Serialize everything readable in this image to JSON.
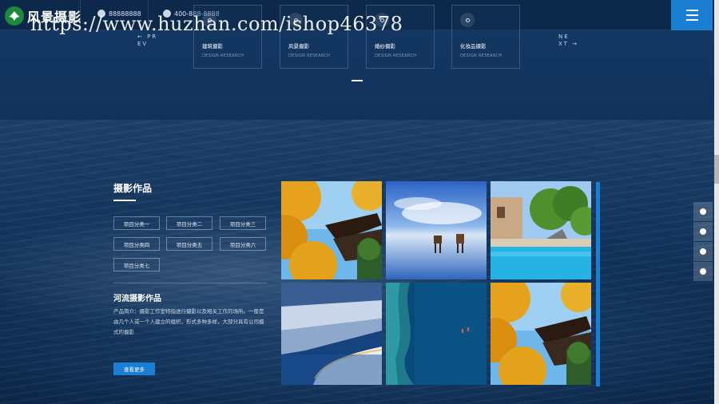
{
  "logo": {
    "text": "风景摄影"
  },
  "header": {
    "email": "88888888",
    "phone": "400-888-8888"
  },
  "watermark": "https://www.huzhan.com/ishop46378",
  "carousel": {
    "prev_label": "← PR EV",
    "next_label": "NE XT →",
    "cards": [
      {
        "title": "建筑摄影",
        "subtitle": "DESIGN RESEARCH"
      },
      {
        "title": "风景摄影",
        "subtitle": "DESIGN RESEARCH"
      },
      {
        "title": "婚纱摄影",
        "subtitle": "DESIGN RESEARCH"
      },
      {
        "title": "化妆品摄影",
        "subtitle": "DESIGN RESEARCH"
      }
    ]
  },
  "works": {
    "title": "摄影作品",
    "categories": [
      "项目分类一",
      "项目分类二",
      "项目分类三",
      "项目分类四",
      "项目分类五",
      "项目分类六",
      "项目分类七"
    ],
    "featured_title": "河流摄影作品",
    "description": "产品简介：摄影工作室特指进行摄影以及相关工作的场所。一般是由几个人或一个人建立的组织，形式多种多样，大部分具有公司模式的摄影",
    "more_button": "查看更多"
  },
  "photos": [
    {
      "name": "temple-ginkgo",
      "accent": "#e6a21c"
    },
    {
      "name": "horses-salt-lake",
      "accent": "#3f76c8"
    },
    {
      "name": "pool-villa",
      "accent": "#2bb3e6"
    },
    {
      "name": "snow-coast-night",
      "accent": "#2c5fa0"
    },
    {
      "name": "ocean-aerial",
      "accent": "#0d6f95"
    },
    {
      "name": "temple-ginkgo-2",
      "accent": "#e6a21c"
    }
  ],
  "colors": {
    "accent": "#1a7ed3",
    "background": "#0f2f55"
  }
}
